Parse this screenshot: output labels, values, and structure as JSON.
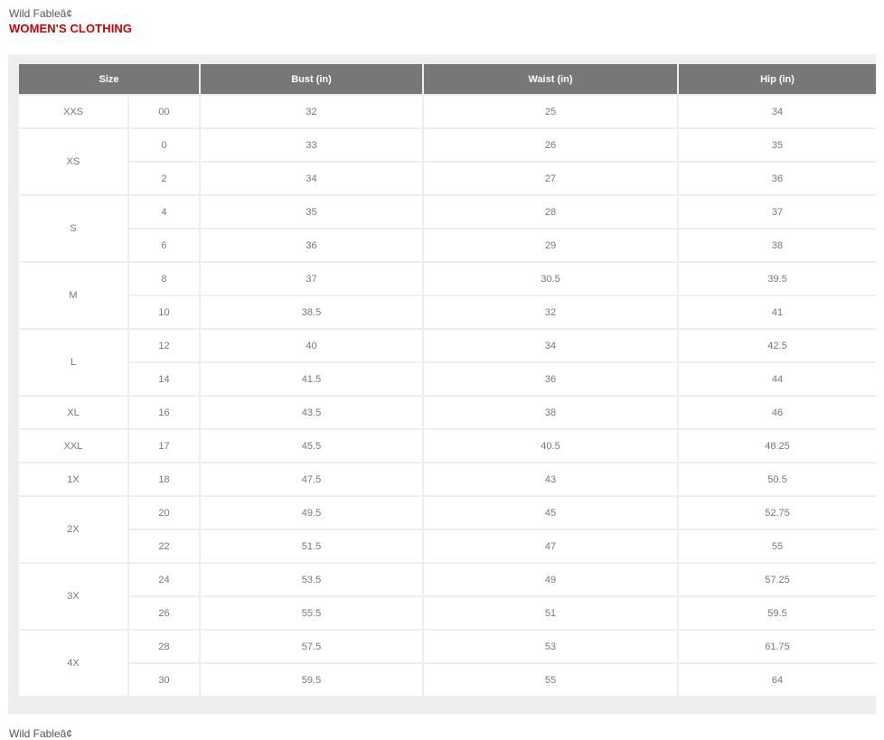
{
  "brand": "Wild Fableâ¢",
  "heading": "WOMEN'S CLOTHING",
  "table": {
    "headers": [
      "Size",
      "Bust (in)",
      "Waist (in)",
      "Hip (in)"
    ],
    "groups": [
      {
        "label": "XXS",
        "rows": [
          {
            "num": "00",
            "bust": "32",
            "waist": "25",
            "hip": "34"
          }
        ]
      },
      {
        "label": "XS",
        "rows": [
          {
            "num": "0",
            "bust": "33",
            "waist": "26",
            "hip": "35"
          },
          {
            "num": "2",
            "bust": "34",
            "waist": "27",
            "hip": "36"
          }
        ]
      },
      {
        "label": "S",
        "rows": [
          {
            "num": "4",
            "bust": "35",
            "waist": "28",
            "hip": "37"
          },
          {
            "num": "6",
            "bust": "36",
            "waist": "29",
            "hip": "38"
          }
        ]
      },
      {
        "label": "M",
        "rows": [
          {
            "num": "8",
            "bust": "37",
            "waist": "30.5",
            "hip": "39.5"
          },
          {
            "num": "10",
            "bust": "38.5",
            "waist": "32",
            "hip": "41"
          }
        ]
      },
      {
        "label": "L",
        "rows": [
          {
            "num": "12",
            "bust": "40",
            "waist": "34",
            "hip": "42.5"
          },
          {
            "num": "14",
            "bust": "41.5",
            "waist": "36",
            "hip": "44"
          }
        ]
      },
      {
        "label": "XL",
        "rows": [
          {
            "num": "16",
            "bust": "43.5",
            "waist": "38",
            "hip": "46"
          }
        ]
      },
      {
        "label": "XXL",
        "rows": [
          {
            "num": "17",
            "bust": "45.5",
            "waist": "40.5",
            "hip": "48.25"
          }
        ]
      },
      {
        "label": "1X",
        "rows": [
          {
            "num": "18",
            "bust": "47.5",
            "waist": "43",
            "hip": "50.5"
          }
        ]
      },
      {
        "label": "2X",
        "rows": [
          {
            "num": "20",
            "bust": "49.5",
            "waist": "45",
            "hip": "52.75"
          },
          {
            "num": "22",
            "bust": "51.5",
            "waist": "47",
            "hip": "55"
          }
        ]
      },
      {
        "label": "3X",
        "rows": [
          {
            "num": "24",
            "bust": "53.5",
            "waist": "49",
            "hip": "57.25"
          },
          {
            "num": "26",
            "bust": "55.5",
            "waist": "51",
            "hip": "59.5"
          }
        ]
      },
      {
        "label": "4X",
        "rows": [
          {
            "num": "28",
            "bust": "57.5",
            "waist": "53",
            "hip": "61.75"
          },
          {
            "num": "30",
            "bust": "59.5",
            "waist": "55",
            "hip": "64"
          }
        ]
      }
    ]
  },
  "footer_brand": "Wild Fableâ¢"
}
